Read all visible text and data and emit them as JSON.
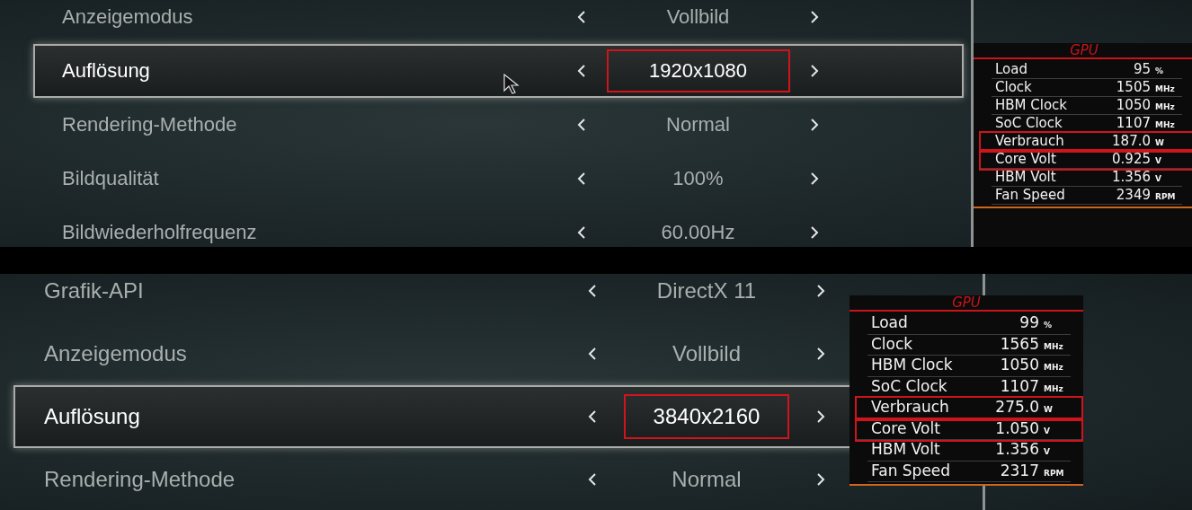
{
  "screens": [
    {
      "settings": [
        {
          "label": "Anzeigemodus",
          "value": "Vollbild",
          "selected": false,
          "highlighted": false
        },
        {
          "label": "Auflösung",
          "value": "1920x1080",
          "selected": true,
          "highlighted": true
        },
        {
          "label": "Rendering-Methode",
          "value": "Normal",
          "selected": false,
          "highlighted": false
        },
        {
          "label": "Bildqualität",
          "value": "100%",
          "selected": false,
          "highlighted": false
        },
        {
          "label": "Bildwiederholfrequenz",
          "value": "60.00Hz",
          "selected": false,
          "highlighted": false
        }
      ],
      "gpu": {
        "title": "GPU",
        "stats": [
          {
            "label": "Load",
            "value": "95",
            "unit": "%",
            "highlighted": false
          },
          {
            "label": "Clock",
            "value": "1505",
            "unit": "MHz",
            "highlighted": false
          },
          {
            "label": "HBM Clock",
            "value": "1050",
            "unit": "MHz",
            "highlighted": false
          },
          {
            "label": "SoC Clock",
            "value": "1107",
            "unit": "MHz",
            "highlighted": false
          },
          {
            "label": "Verbrauch",
            "value": "187.0",
            "unit": "W",
            "highlighted": true
          },
          {
            "label": "Core Volt",
            "value": "0.925",
            "unit": "V",
            "highlighted": true
          },
          {
            "label": "HBM Volt",
            "value": "1.356",
            "unit": "V",
            "highlighted": false
          },
          {
            "label": "Fan Speed",
            "value": "2349",
            "unit": "RPM",
            "highlighted": false
          }
        ]
      }
    },
    {
      "settings": [
        {
          "label": "Grafik-API",
          "value": "DirectX 11",
          "selected": false,
          "highlighted": false
        },
        {
          "label": "Anzeigemodus",
          "value": "Vollbild",
          "selected": false,
          "highlighted": false
        },
        {
          "label": "Auflösung",
          "value": "3840x2160",
          "selected": true,
          "highlighted": true
        },
        {
          "label": "Rendering-Methode",
          "value": "Normal",
          "selected": false,
          "highlighted": false
        }
      ],
      "gpu": {
        "title": "GPU",
        "stats": [
          {
            "label": "Load",
            "value": "99",
            "unit": "%",
            "highlighted": false
          },
          {
            "label": "Clock",
            "value": "1565",
            "unit": "MHz",
            "highlighted": false
          },
          {
            "label": "HBM Clock",
            "value": "1050",
            "unit": "MHz",
            "highlighted": false
          },
          {
            "label": "SoC Clock",
            "value": "1107",
            "unit": "MHz",
            "highlighted": false
          },
          {
            "label": "Verbrauch",
            "value": "275.0",
            "unit": "W",
            "highlighted": true
          },
          {
            "label": "Core Volt",
            "value": "1.050",
            "unit": "V",
            "highlighted": true
          },
          {
            "label": "HBM Volt",
            "value": "1.356",
            "unit": "V",
            "highlighted": false
          },
          {
            "label": "Fan Speed",
            "value": "2317",
            "unit": "RPM",
            "highlighted": false
          }
        ]
      }
    }
  ]
}
